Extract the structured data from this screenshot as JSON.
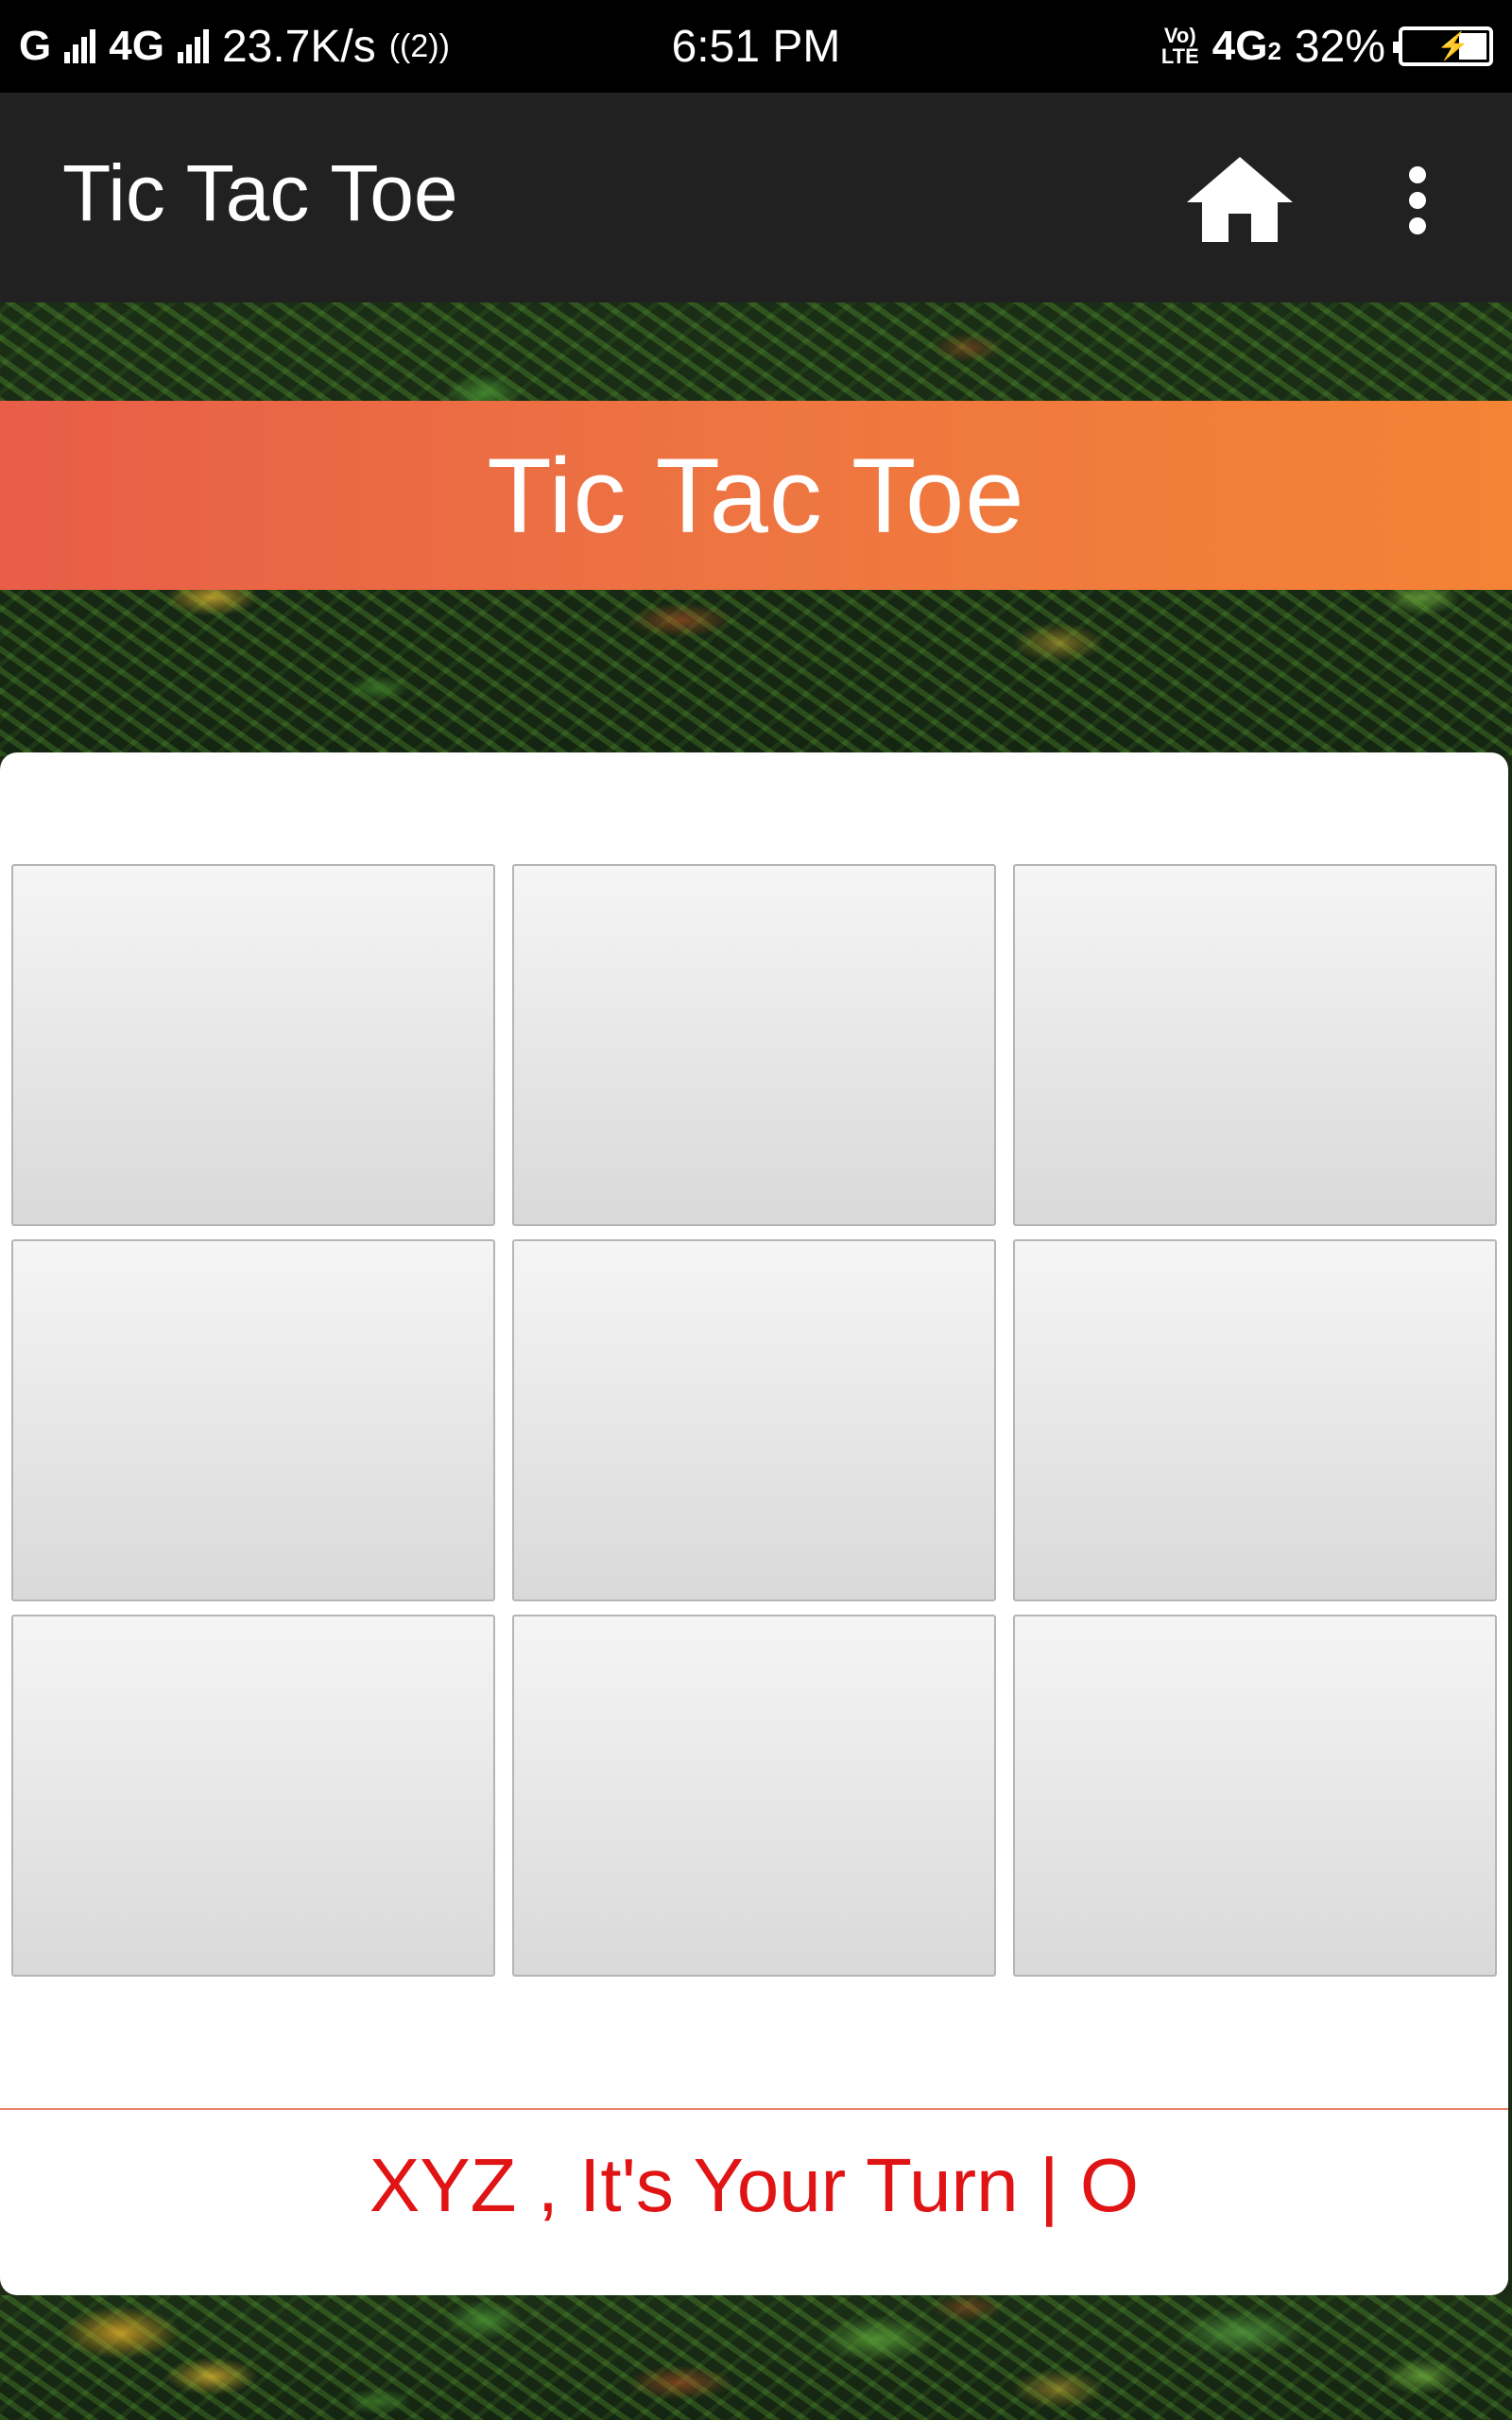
{
  "status_bar": {
    "carrier_left": "G",
    "network_left": "4G",
    "net_speed": "23.7K/s",
    "hotspot_indicator": "2",
    "time": "6:51 PM",
    "volte_top": "Vo)",
    "volte_bottom": "LTE",
    "network_right": "4G",
    "network_right_sub": "2",
    "battery_percent": "32%",
    "battery_level": 0.32,
    "icons": [
      "signal-icon",
      "hotspot-icon",
      "volte-icon",
      "battery-charging-icon"
    ]
  },
  "app_bar": {
    "title": "Tic Tac Toe",
    "actions": [
      "home-icon",
      "overflow-menu-icon"
    ]
  },
  "banner": {
    "title": "Tic Tac Toe"
  },
  "board": {
    "cells": [
      "",
      "",
      "",
      "",
      "",
      "",
      "",
      "",
      ""
    ]
  },
  "turn": {
    "message": "XYZ , It's Your Turn | O",
    "color": "#e01414"
  },
  "colors": {
    "app_bar": "#212121",
    "banner_start": "#e85d48",
    "banner_end": "#f58335",
    "divider": "#e8826e"
  }
}
